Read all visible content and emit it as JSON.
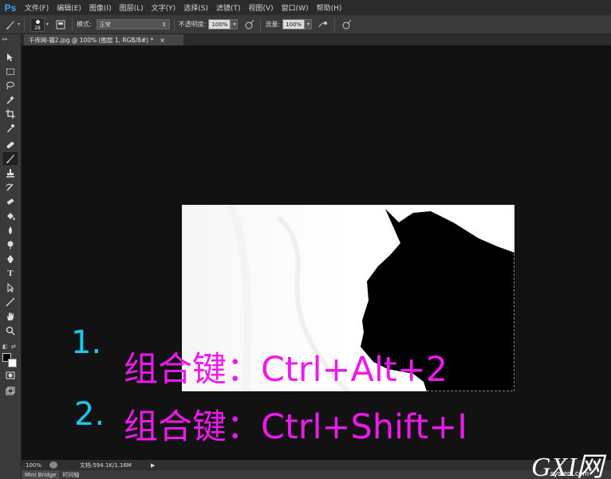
{
  "app": {
    "logo": "Ps"
  },
  "menu": [
    "文件(F)",
    "编辑(E)",
    "图像(I)",
    "图层(L)",
    "文字(Y)",
    "选择(S)",
    "滤镜(T)",
    "视图(V)",
    "窗口(W)",
    "帮助(H)"
  ],
  "options": {
    "brush_size": "28",
    "mode_label": "模式:",
    "mode_value": "正常",
    "opacity_label": "不透明度:",
    "opacity_value": "100%",
    "flow_label": "流量:",
    "flow_value": "100%"
  },
  "document_tab": {
    "title": "千库网-猫2.jpg @ 100% (图层 1, RGB/8#) *",
    "close": "×"
  },
  "canvas": {
    "steps": [
      {
        "number": "1.",
        "text": "组合键：Ctrl+Alt+2"
      },
      {
        "number": "2.",
        "text": "组合键：Ctrl+Shift+I"
      }
    ]
  },
  "status": {
    "zoom": "100%",
    "doc_info": "文档:594.1K/1.16M",
    "arrow": "▶"
  },
  "bottom_tabs": [
    "Mini Bridge",
    "时间轴"
  ],
  "watermark": {
    "main": "GXI网",
    "sub": "system.com"
  },
  "colors": {
    "accent_ps": "#31a8ff",
    "note_magenta": "#ee19ee",
    "step_cyan": "#19c8f0"
  }
}
